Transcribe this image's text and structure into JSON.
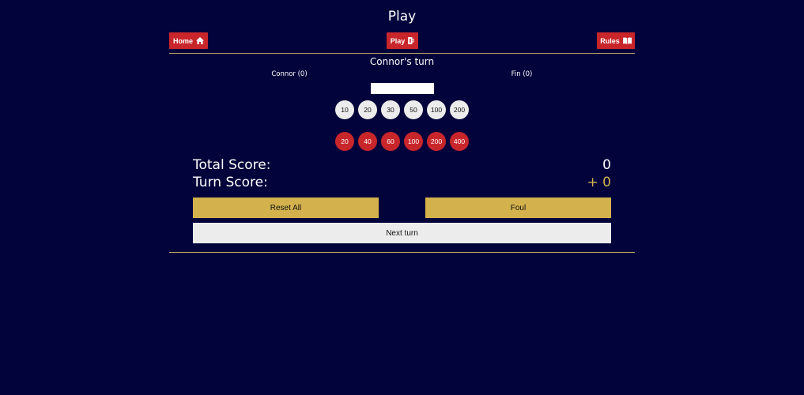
{
  "page": {
    "title": "Play"
  },
  "nav": {
    "home": {
      "label": "Home",
      "icon": "home-icon"
    },
    "play": {
      "label": "Play",
      "icon": "beer-mug-icon"
    },
    "rules": {
      "label": "Rules",
      "icon": "book-open-icon"
    }
  },
  "game": {
    "turn_title": "Connor's turn",
    "players": [
      "Connor (0)",
      "Fin (0)"
    ],
    "score_input": {
      "value": "",
      "placeholder": ""
    },
    "white_balls": [
      "10",
      "20",
      "30",
      "50",
      "100",
      "200"
    ],
    "red_balls": [
      "20",
      "40",
      "60",
      "100",
      "200",
      "400"
    ],
    "total_score": {
      "label": "Total Score:",
      "value": "0"
    },
    "turn_score": {
      "label": "Turn Score:",
      "value": "+ 0"
    }
  },
  "actions": {
    "reset": "Reset All",
    "foul": "Foul",
    "next": "Next turn"
  },
  "colors": {
    "background": "#02033a",
    "nav_button": "#c8262b",
    "gold": "#d3b24d",
    "light": "#ececec"
  }
}
